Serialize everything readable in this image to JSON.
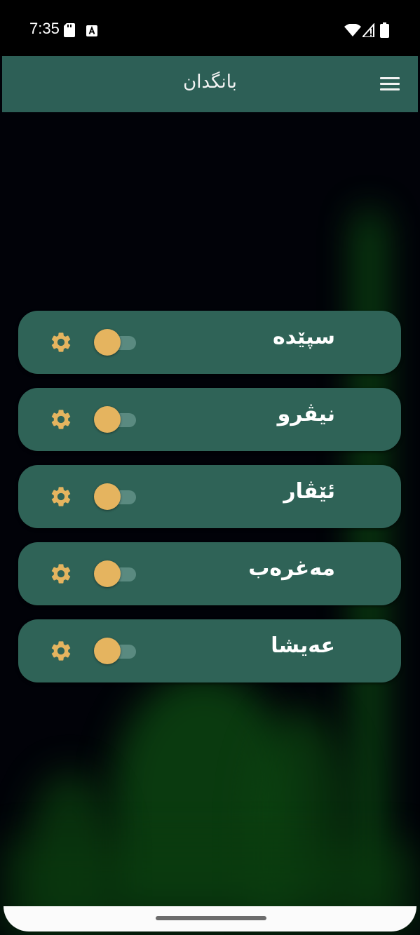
{
  "status_bar": {
    "time": "7:35",
    "icons": [
      "sd-card-icon",
      "keyboard-a-icon",
      "wifi-icon",
      "signal-icon",
      "battery-icon"
    ]
  },
  "app_bar": {
    "title": "بانگدان",
    "menu_icon": "hamburger-menu-icon"
  },
  "prayers": [
    {
      "name": "سپێدە",
      "enabled": false
    },
    {
      "name": "نیڤرو",
      "enabled": false
    },
    {
      "name": "ئێڤار",
      "enabled": false
    },
    {
      "name": "مەغرەب",
      "enabled": false
    },
    {
      "name": "عەیشا",
      "enabled": false
    }
  ],
  "colors": {
    "app_bar": "#2d5f56",
    "row_background": "#2f6357",
    "accent": "#e5b45f"
  }
}
